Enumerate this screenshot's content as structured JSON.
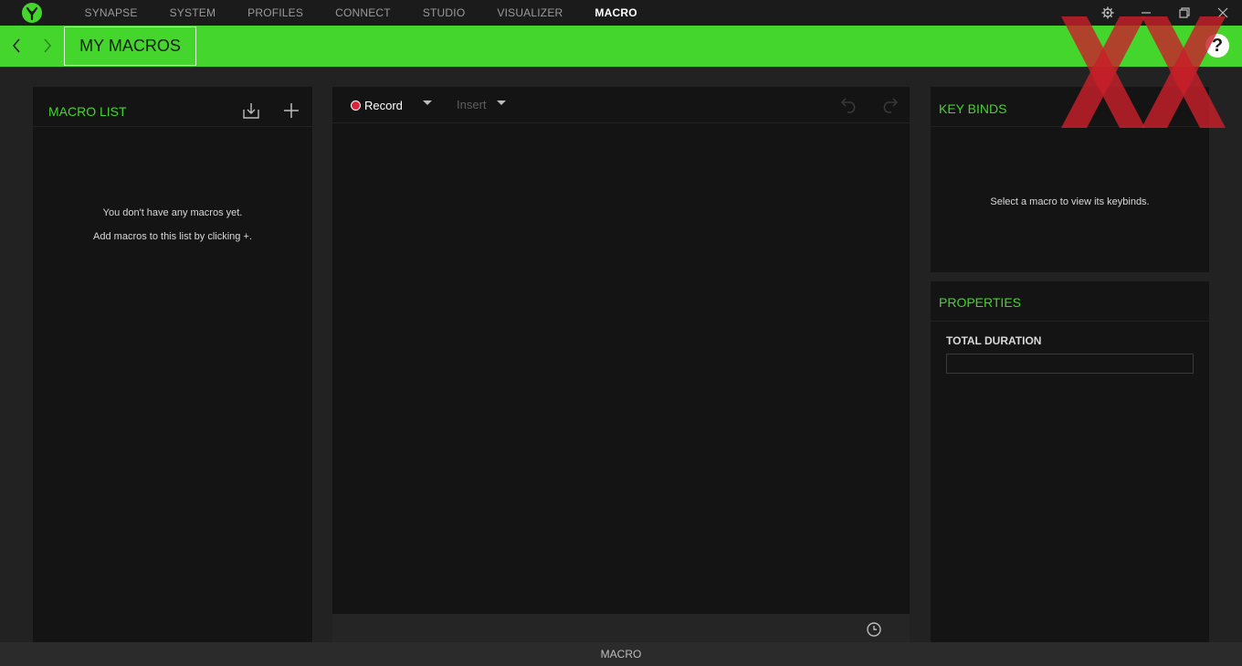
{
  "nav": {
    "items": [
      "SYNAPSE",
      "SYSTEM",
      "PROFILES",
      "CONNECT",
      "STUDIO",
      "VISUALIZER",
      "MACRO"
    ],
    "active_index": 6
  },
  "header": {
    "subtab": "MY MACROS",
    "help": "?"
  },
  "macro_list": {
    "title": "MACRO LIST",
    "empty_line1": "You don't have any macros yet.",
    "empty_line2": "Add macros to this list by clicking +."
  },
  "editor": {
    "record_label": "Record",
    "insert_label": "Insert"
  },
  "keybinds": {
    "title": "KEY BINDS",
    "message": "Select a macro to view its keybinds."
  },
  "properties": {
    "title": "PROPERTIES",
    "total_duration_label": "TOTAL DURATION",
    "total_duration_value": ""
  },
  "statusbar": {
    "label": "MACRO"
  },
  "colors": {
    "accent": "#44d62c",
    "panel": "#141414",
    "background": "#222222",
    "record": "#e0223b",
    "watermark": "#c8202a"
  },
  "icons": [
    "razer-logo-icon",
    "settings-gear-icon",
    "minimize-icon",
    "restore-icon",
    "close-icon",
    "chevron-left-icon",
    "chevron-right-icon",
    "help-icon",
    "import-icon",
    "add-icon",
    "undo-icon",
    "redo-icon",
    "timer-icon"
  ]
}
